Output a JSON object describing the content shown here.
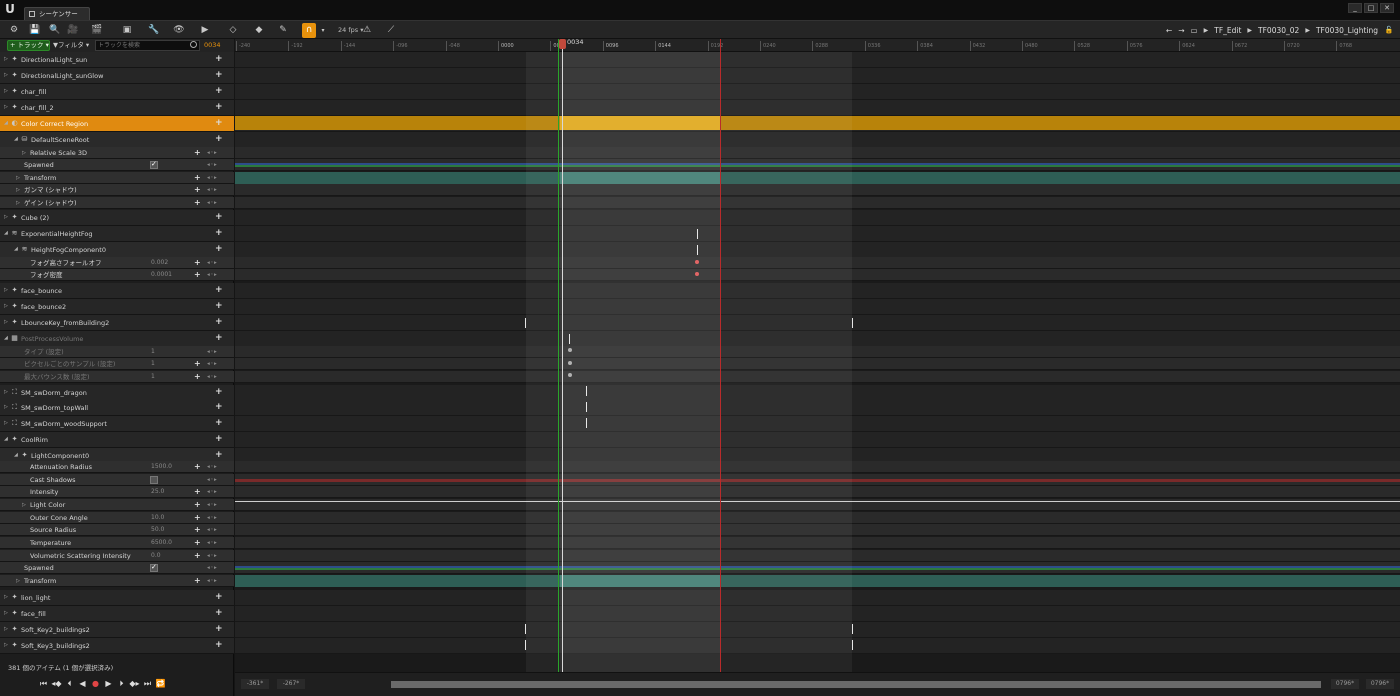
{
  "window": {
    "tab_label": "シーケンサー",
    "controls": [
      "_",
      "□",
      "✕"
    ]
  },
  "toolbar": {
    "fps_label": "24 fps",
    "breadcrumb": [
      "TF_Edit",
      "TF0030_02",
      "TF0030_Lighting"
    ]
  },
  "tracks_header": {
    "add_track_label": "+ トラック ▾",
    "filter_label": "▼フィルタ ▾",
    "search_placeholder": "トラックを検索",
    "current_frame": "0034"
  },
  "tracks": [
    {
      "label": "DirectionalLight_sun",
      "type": "actor",
      "icon": "light-icon",
      "expanded": false
    },
    {
      "label": "DirectionalLight_sunGlow",
      "type": "actor",
      "icon": "light-icon",
      "expanded": false
    },
    {
      "label": "char_fill",
      "type": "actor",
      "icon": "light-icon",
      "expanded": false
    },
    {
      "label": "char_fill_2",
      "type": "actor",
      "icon": "light-icon",
      "expanded": false
    },
    {
      "label": "Color Correct Region",
      "type": "actor",
      "icon": "region-icon",
      "expanded": true,
      "selected": true
    },
    {
      "label": "DefaultSceneRoot",
      "type": "component",
      "icon": "component-icon",
      "expanded": true
    },
    {
      "label": "Relative Scale 3D",
      "type": "prop",
      "indent": 2,
      "plus": true,
      "expandable": true
    },
    {
      "label": "Spawned",
      "type": "prop",
      "indent": 1,
      "check": true
    },
    {
      "label": "Transform",
      "type": "prop",
      "indent": 1,
      "plus": true,
      "expandable": true
    },
    {
      "label": "ガンマ (シャドウ)",
      "type": "prop",
      "indent": 1,
      "plus": true,
      "expandable": true
    },
    {
      "label": "ゲイン (シャドウ)",
      "type": "prop",
      "indent": 1,
      "plus": true,
      "expandable": true
    },
    {
      "label": "Cube (2)",
      "type": "actor",
      "icon": "light-icon",
      "expanded": false
    },
    {
      "label": "ExponentialHeightFog",
      "type": "actor",
      "icon": "fog-icon",
      "expanded": true
    },
    {
      "label": "HeightFogComponent0",
      "type": "component",
      "icon": "fog-icon",
      "expanded": true
    },
    {
      "label": "フォグ高さフォールオフ",
      "type": "prop",
      "indent": 2,
      "value": "0.002",
      "plus": true
    },
    {
      "label": "フォグ密度",
      "type": "prop",
      "indent": 2,
      "value": "0.0001",
      "plus": true
    },
    {
      "label": "face_bounce",
      "type": "actor",
      "icon": "light-icon",
      "expanded": false
    },
    {
      "label": "face_bounce2",
      "type": "actor",
      "icon": "light-icon",
      "expanded": false
    },
    {
      "label": "LbounceKey_fromBuilding2",
      "type": "actor",
      "icon": "light-icon",
      "expanded": false
    },
    {
      "label": "PostProcessVolume",
      "type": "actor",
      "icon": "volume-icon",
      "expanded": true,
      "dim": true
    },
    {
      "label": "タイプ (設定)",
      "type": "prop",
      "indent": 1,
      "value": "1",
      "dim": true
    },
    {
      "label": "ピクセルごとのサンプル (設定)",
      "type": "prop",
      "indent": 1,
      "value": "1",
      "plus": true,
      "dim": true
    },
    {
      "label": "最大バウンス数 (設定)",
      "type": "prop",
      "indent": 1,
      "value": "1",
      "plus": true,
      "dim": true
    },
    {
      "label": "SM_swDorm_dragon",
      "type": "actor",
      "icon": "mesh-icon",
      "expanded": false
    },
    {
      "label": "SM_swDorm_topWall",
      "type": "actor",
      "icon": "mesh-icon",
      "expanded": false
    },
    {
      "label": "SM_swDorm_woodSupport",
      "type": "actor",
      "icon": "mesh-icon",
      "expanded": false
    },
    {
      "label": "CoolRim",
      "type": "actor",
      "icon": "light-icon",
      "expanded": true
    },
    {
      "label": "LightComponent0",
      "type": "component",
      "icon": "light-icon",
      "expanded": true
    },
    {
      "label": "Attenuation Radius",
      "type": "prop",
      "indent": 2,
      "value": "1500.0",
      "plus": true
    },
    {
      "label": "Cast Shadows",
      "type": "prop",
      "indent": 2,
      "check": false
    },
    {
      "label": "Intensity",
      "type": "prop",
      "indent": 2,
      "value": "25.0",
      "plus": true
    },
    {
      "label": "Light Color",
      "type": "prop",
      "indent": 2,
      "plus": true,
      "expandable": true
    },
    {
      "label": "Outer Cone Angle",
      "type": "prop",
      "indent": 2,
      "value": "10.0",
      "plus": true
    },
    {
      "label": "Source Radius",
      "type": "prop",
      "indent": 2,
      "value": "50.0",
      "plus": true
    },
    {
      "label": "Temperature",
      "type": "prop",
      "indent": 2,
      "value": "6500.0",
      "plus": true
    },
    {
      "label": "Volumetric Scattering Intensity",
      "type": "prop",
      "indent": 2,
      "value": "0.0",
      "plus": true
    },
    {
      "label": "Spawned",
      "type": "prop",
      "indent": 1,
      "check": true
    },
    {
      "label": "Transform",
      "type": "prop",
      "indent": 1,
      "plus": true,
      "expandable": true
    },
    {
      "label": "lion_light",
      "type": "actor",
      "icon": "light-icon",
      "expanded": false
    },
    {
      "label": "face_fill",
      "type": "actor",
      "icon": "light-icon",
      "expanded": false
    },
    {
      "label": "Soft_Key2_buildings2",
      "type": "actor",
      "icon": "light-icon",
      "expanded": false
    },
    {
      "label": "Soft_Key3_buildings2",
      "type": "actor",
      "icon": "light-icon",
      "expanded": false
    }
  ],
  "status": {
    "item_count": "381 個のアイテム (1 個が選択済み)"
  },
  "timeline": {
    "ruler_ticks": [
      "-240",
      "-192",
      "-144",
      "-096",
      "-048",
      "0000",
      "0048",
      "0096",
      "0144",
      "0192",
      "0240",
      "0288",
      "0336",
      "0384",
      "0432",
      "0480",
      "0528",
      "0576",
      "0624",
      "0672",
      "0720",
      "0768"
    ],
    "playhead_frame": "0034",
    "view_start": "-361*",
    "view_end": "-267*",
    "working_start": "0796*",
    "working_end": "0796*"
  },
  "colors": {
    "accent": "#e08a10",
    "selection_bar": "#e0a616",
    "teal_bar": "#3d7a6e",
    "playhead": "#c24a3c",
    "start_marker": "#2aa52a",
    "end_marker": "#b92b2b"
  }
}
